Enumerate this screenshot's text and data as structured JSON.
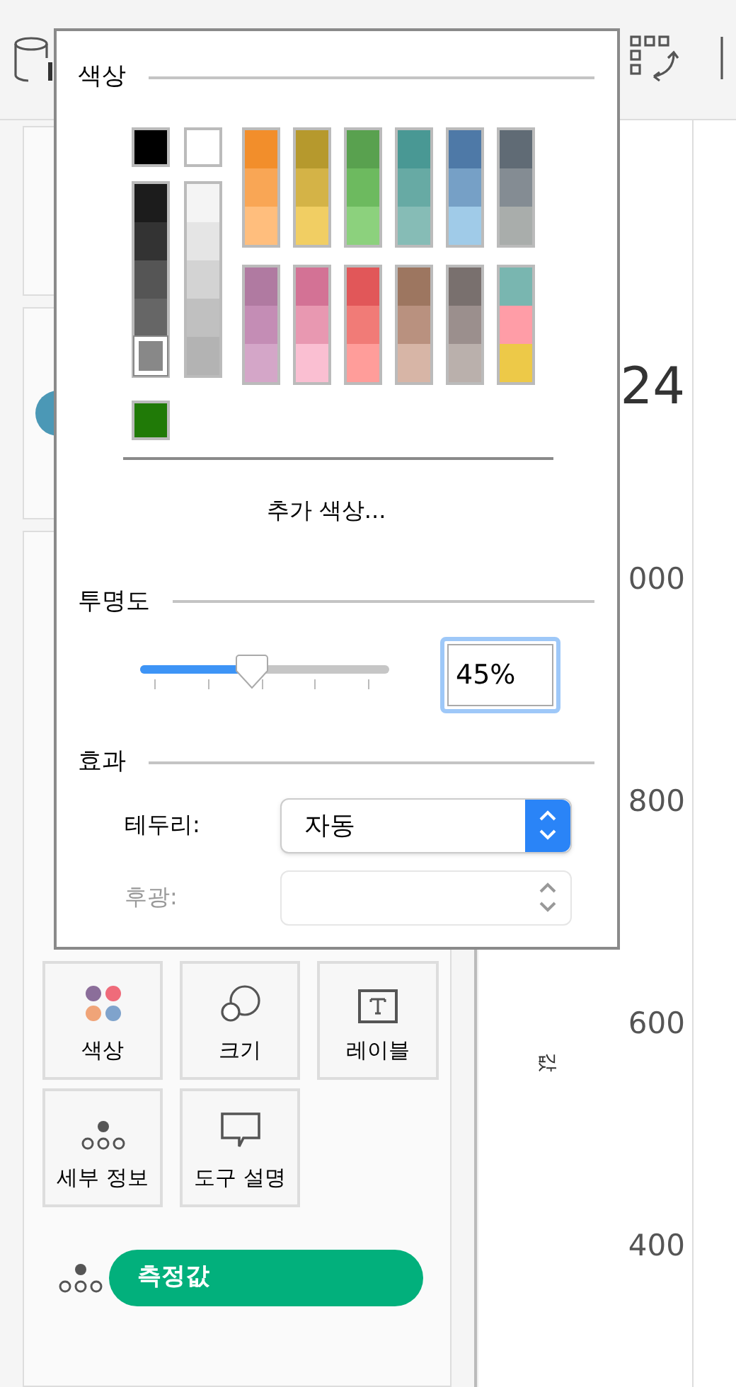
{
  "popup": {
    "color_heading": "색상",
    "palette": {
      "top_pair": [
        {
          "color": "#000000",
          "selected": false
        },
        {
          "color": "#ffffff",
          "selected": false
        }
      ],
      "gray_columns": [
        [
          {
            "color": "#1c1c1c",
            "selected": false
          },
          {
            "color": "#333333",
            "selected": false
          },
          {
            "color": "#555555",
            "selected": false
          },
          {
            "color": "#666666",
            "selected": false
          },
          {
            "color": "#888888",
            "selected": true
          }
        ],
        [
          {
            "color": "#f4f4f4",
            "selected": false
          },
          {
            "color": "#e5e5e5",
            "selected": false
          },
          {
            "color": "#d3d3d3",
            "selected": false
          },
          {
            "color": "#c0c0c0",
            "selected": false
          },
          {
            "color": "#b3b3b3",
            "selected": false
          }
        ]
      ],
      "upper_columns": [
        [
          {
            "color": "#f28e2b",
            "selected": false
          },
          {
            "color": "#f9a655",
            "selected": false
          },
          {
            "color": "#ffbe7d",
            "selected": false
          }
        ],
        [
          {
            "color": "#b6992d",
            "selected": false
          },
          {
            "color": "#d4b347",
            "selected": false
          },
          {
            "color": "#f1ce63",
            "selected": false
          }
        ],
        [
          {
            "color": "#59a14f",
            "selected": false
          },
          {
            "color": "#6dba5f",
            "selected": false
          },
          {
            "color": "#8cd17d",
            "selected": false
          }
        ],
        [
          {
            "color": "#499894",
            "selected": false
          },
          {
            "color": "#67aaa4",
            "selected": false
          },
          {
            "color": "#86bcb6",
            "selected": false
          }
        ],
        [
          {
            "color": "#4e79a7",
            "selected": false
          },
          {
            "color": "#76a0c6",
            "selected": false
          },
          {
            "color": "#a0cbe8",
            "selected": false
          }
        ],
        [
          {
            "color": "#606b75",
            "selected": false
          },
          {
            "color": "#848c93",
            "selected": false
          },
          {
            "color": "#a9adab",
            "selected": false
          }
        ]
      ],
      "lower_columns": [
        [
          {
            "color": "#b07aa1",
            "selected": false
          },
          {
            "color": "#c48db5",
            "selected": false
          },
          {
            "color": "#d4a6c8",
            "selected": false
          }
        ],
        [
          {
            "color": "#d37295",
            "selected": false
          },
          {
            "color": "#e898b1",
            "selected": false
          },
          {
            "color": "#fabfd2",
            "selected": false
          }
        ],
        [
          {
            "color": "#e15759",
            "selected": false
          },
          {
            "color": "#f17b77",
            "selected": false
          },
          {
            "color": "#ff9d9a",
            "selected": false
          }
        ],
        [
          {
            "color": "#9d7660",
            "selected": false
          },
          {
            "color": "#b9917f",
            "selected": false
          },
          {
            "color": "#d7b5a6",
            "selected": false
          }
        ],
        [
          {
            "color": "#79706e",
            "selected": false
          },
          {
            "color": "#9b8f8d",
            "selected": false
          },
          {
            "color": "#bab0ac",
            "selected": false
          }
        ],
        [
          {
            "color": "#79b6b0",
            "selected": false
          },
          {
            "color": "#ff9da7",
            "selected": false
          },
          {
            "color": "#edc948",
            "selected": false
          }
        ]
      ],
      "custom": [
        {
          "color": "#207a07",
          "selected": false
        }
      ]
    },
    "more_colors": "추가 색상...",
    "opacity_heading": "투명도",
    "opacity": {
      "level": 0.45,
      "value": "45%"
    },
    "effects_heading": "효과",
    "effects": [
      {
        "label": "테두리:",
        "value": "자동",
        "disabled": false
      },
      {
        "label": "후광:",
        "disabled": true
      }
    ]
  },
  "marks": {
    "buttons": [
      {
        "kind": "color",
        "label": "색상"
      },
      {
        "kind": "size",
        "label": "크기"
      },
      {
        "kind": "label",
        "label": "레이블"
      },
      {
        "kind": "detail",
        "label": "세부 정보"
      },
      {
        "kind": "tooltip",
        "label": "도구 설명"
      }
    ],
    "pill": {
      "label": "측정값"
    }
  },
  "chart": {
    "title_fragment": "24",
    "y_axis_label": "값",
    "y_ticks": [
      "000",
      "800",
      "600",
      "400"
    ]
  }
}
